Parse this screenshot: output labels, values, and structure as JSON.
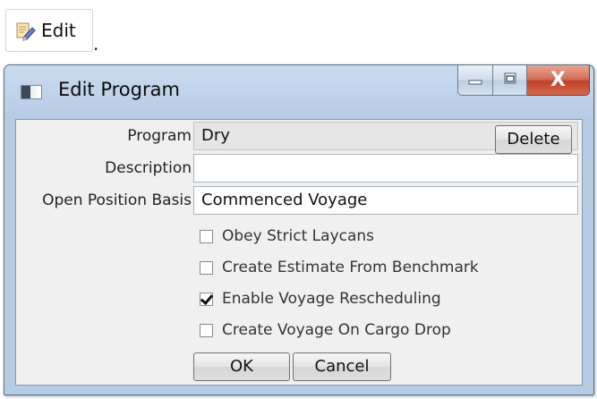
{
  "toolbar": {
    "edit_label": "Edit",
    "edit_icon": "edit-document-pencil-icon",
    "trailing_dot": "."
  },
  "window": {
    "title": "Edit Program",
    "app_icon": "window-app-icon",
    "controls": {
      "minimize_icon": "minimize-icon",
      "maximize_icon": "maximize-icon",
      "close_symbol": "X"
    }
  },
  "form": {
    "program": {
      "label": "Program",
      "value": "Dry",
      "delete_label": "Delete"
    },
    "description": {
      "label": "Description",
      "value": ""
    },
    "open_position_basis": {
      "label": "Open Position Basis",
      "value": "Commenced Voyage"
    },
    "options": [
      {
        "label": "Obey Strict Laycans",
        "checked": false
      },
      {
        "label": "Create Estimate From Benchmark",
        "checked": false
      },
      {
        "label": "Enable Voyage Rescheduling",
        "checked": true
      },
      {
        "label": "Create Voyage On Cargo Drop",
        "checked": false
      }
    ],
    "ok_label": "OK",
    "cancel_label": "Cancel"
  },
  "colors": {
    "window_frame": "#b6cce5",
    "close_button": "#c0412a",
    "client_background": "#f0f0f0"
  }
}
